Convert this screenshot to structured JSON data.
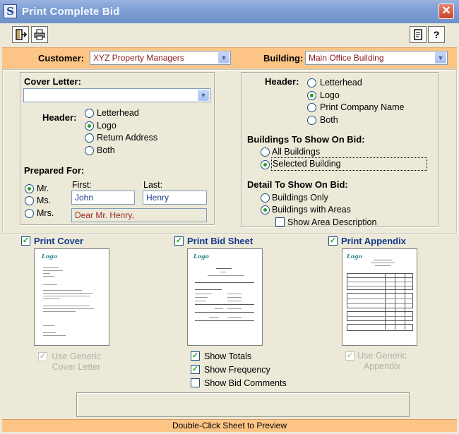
{
  "window": {
    "title": "Print Complete Bid",
    "app_icon": "S"
  },
  "toolbar": {
    "left_buttons": [
      "exit-icon",
      "printer-icon"
    ],
    "right_buttons": [
      "report-icon",
      "help-icon"
    ],
    "help_glyph": "?"
  },
  "customer_bar": {
    "customer_label": "Customer:",
    "customer_value": "XYZ Property Managers",
    "building_label": "Building:",
    "building_value": "Main Office Building"
  },
  "cover_letter": {
    "label": "Cover Letter:",
    "value": "",
    "header_label": "Header:",
    "header_options": [
      "Letterhead",
      "Logo",
      "Return Address",
      "Both"
    ],
    "header_selected": "Logo",
    "prepared_for_label": "Prepared For:",
    "salutations": [
      "Mr.",
      "Ms.",
      "Mrs."
    ],
    "salutation_selected": "Mr.",
    "first_label": "First:",
    "first_value": "John",
    "last_label": "Last:",
    "last_value": "Henry",
    "greeting_value": "Dear Mr. Henry,"
  },
  "bid_options": {
    "header_label": "Header:",
    "header_options": [
      "Letterhead",
      "Logo",
      "Print Company Name",
      "Both"
    ],
    "header_selected": "Logo",
    "buildings_label": "Buildings To Show On Bid:",
    "buildings_options": [
      "All Buildings",
      "Selected Building"
    ],
    "buildings_selected": "Selected Building",
    "detail_label": "Detail To Show On Bid:",
    "detail_options": [
      "Buildings Only",
      "Buildings with Areas"
    ],
    "detail_selected": "Buildings with Areas",
    "show_area_description": "Show Area Description"
  },
  "print_sections": {
    "cover": {
      "label": "Print Cover",
      "checked": true,
      "generic_label": "Use Generic Cover Letter"
    },
    "bid_sheet": {
      "label": "Print Bid Sheet",
      "checked": true,
      "options": [
        {
          "label": "Show Totals",
          "checked": true
        },
        {
          "label": "Show Frequency",
          "checked": true
        },
        {
          "label": "Show Bid Comments",
          "checked": false
        }
      ]
    },
    "appendix": {
      "label": "Print Appendix",
      "checked": true,
      "generic_label": "Use Generic Appendix"
    }
  },
  "thumbnail_logo": "Logo",
  "comment_box": "",
  "status": {
    "text": "Double-Click Sheet to Preview"
  },
  "colors": {
    "accent_bar": "#fdc585",
    "label_blue": "#143a8d",
    "value_red": "#8b1c1c",
    "check_green": "#21a121"
  }
}
